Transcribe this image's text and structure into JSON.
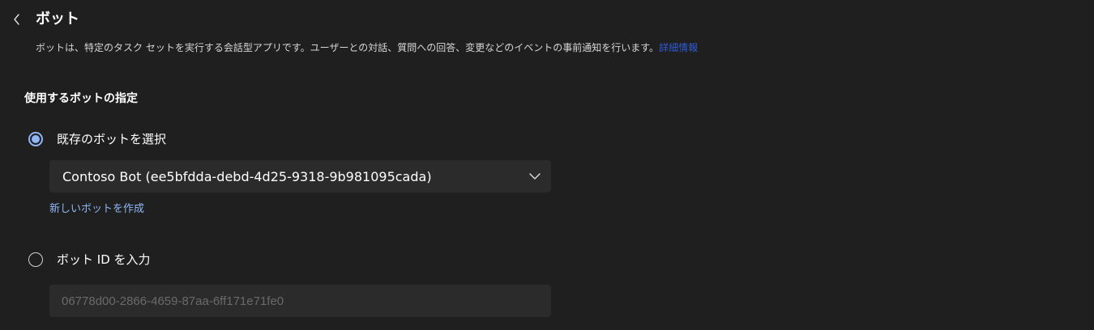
{
  "header": {
    "title": "ボット",
    "description": "ボットは、特定のタスク セットを実行する会話型アプリです。ユーザーとの対話、質問への回答、変更などのイベントの事前通知を行います。",
    "learn_more_link": "詳細情報"
  },
  "section": {
    "label": "使用するボットの指定"
  },
  "options": {
    "existing_bot": {
      "label": "既存のボットを選択",
      "selected": true,
      "dropdown_value": "Contoso Bot (ee5bfdda-debd-4d25-9318-9b981095cada)",
      "create_link": "新しいボットを作成"
    },
    "enter_bot_id": {
      "label": "ボット ID を入力",
      "selected": false,
      "input_placeholder": "06778d00-2866-4659-87aa-6ff171e71fe0"
    }
  },
  "colors": {
    "background": "#1f1f1f",
    "field_background": "#2b2b2b",
    "accent": "#8fb6f5",
    "link": "#2f5bd6"
  },
  "icons": {
    "back": "chevron-left-icon",
    "dropdown": "chevron-down-icon"
  }
}
